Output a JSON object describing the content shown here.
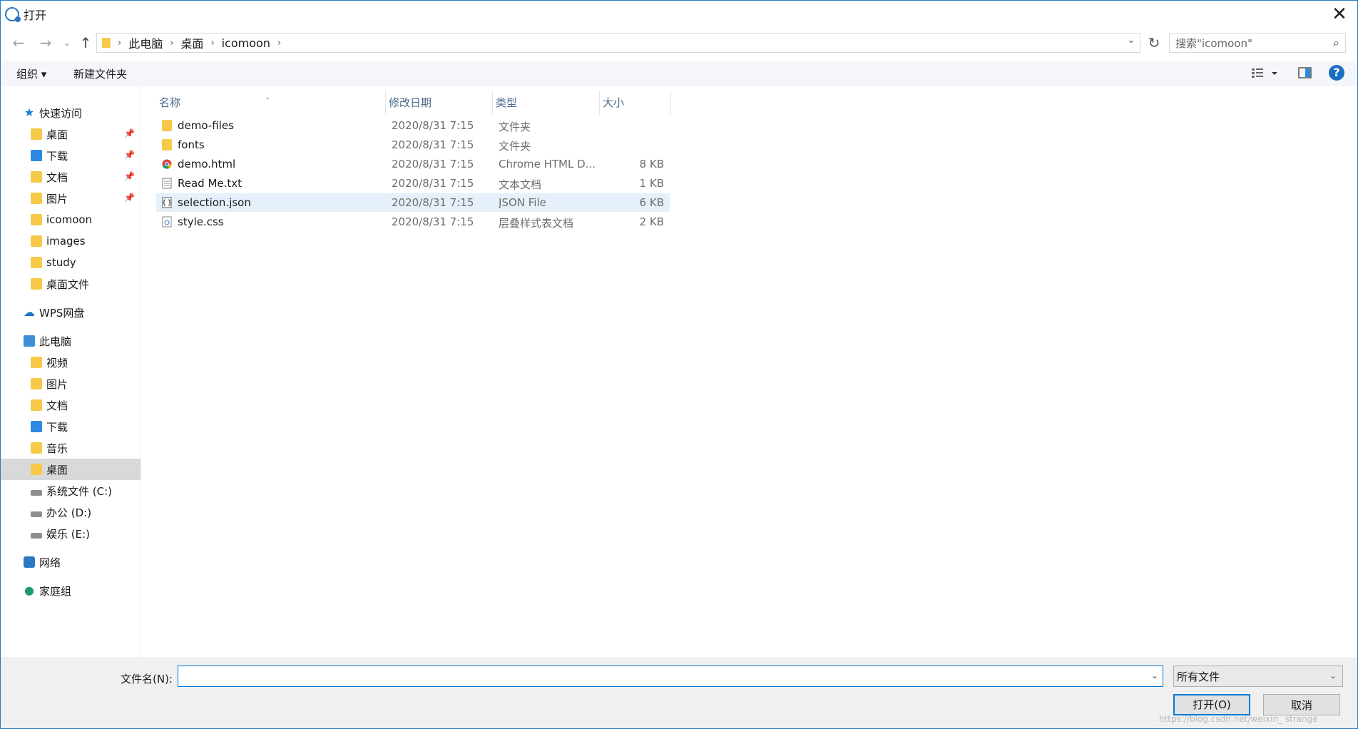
{
  "window": {
    "title": "打开",
    "close_symbol": "✕"
  },
  "nav": {
    "back": "←",
    "forward": "→",
    "recent": "⌄",
    "up": "↑",
    "refresh": "↻"
  },
  "breadcrumb": [
    "此电脑",
    "桌面",
    "icomoon"
  ],
  "search": {
    "placeholder": "搜索\"icomoon\""
  },
  "toolbar": {
    "organize": "组织 ▾",
    "new_folder": "新建文件夹"
  },
  "sidebar": {
    "quick_access": "快速访问",
    "quick_items": [
      {
        "label": "桌面",
        "pinned": true
      },
      {
        "label": "下载",
        "pinned": true
      },
      {
        "label": "文档",
        "pinned": true
      },
      {
        "label": "图片",
        "pinned": true
      },
      {
        "label": "icomoon",
        "pinned": false
      },
      {
        "label": "images",
        "pinned": false
      },
      {
        "label": "study",
        "pinned": false
      },
      {
        "label": "桌面文件",
        "pinned": false
      }
    ],
    "wps": "WPS网盘",
    "this_pc": "此电脑",
    "pc_items": [
      {
        "label": "视频"
      },
      {
        "label": "图片"
      },
      {
        "label": "文档"
      },
      {
        "label": "下载"
      },
      {
        "label": "音乐"
      },
      {
        "label": "桌面",
        "selected": true
      },
      {
        "label": "系统文件 (C:)"
      },
      {
        "label": "办公 (D:)"
      },
      {
        "label": "娱乐 (E:)"
      }
    ],
    "network": "网络",
    "homegroup": "家庭组"
  },
  "columns": {
    "name": "名称",
    "date": "修改日期",
    "type": "类型",
    "size": "大小"
  },
  "files": [
    {
      "name": "demo-files",
      "date": "2020/8/31 7:15",
      "type": "文件夹",
      "size": "",
      "icon": "folder-icon"
    },
    {
      "name": "fonts",
      "date": "2020/8/31 7:15",
      "type": "文件夹",
      "size": "",
      "icon": "folder-icon"
    },
    {
      "name": "demo.html",
      "date": "2020/8/31 7:15",
      "type": "Chrome HTML D...",
      "size": "8 KB",
      "icon": "chrome-icon"
    },
    {
      "name": "Read Me.txt",
      "date": "2020/8/31 7:15",
      "type": "文本文档",
      "size": "1 KB",
      "icon": "text-file-icon"
    },
    {
      "name": "selection.json",
      "date": "2020/8/31 7:15",
      "type": "JSON File",
      "size": "6 KB",
      "icon": "json-file-icon",
      "selected": true
    },
    {
      "name": "style.css",
      "date": "2020/8/31 7:15",
      "type": "层叠样式表文档",
      "size": "2 KB",
      "icon": "css-file-icon"
    }
  ],
  "bottom": {
    "filename_label": "文件名(N):",
    "filename_value": "",
    "filetype": "所有文件",
    "open": "打开(O)",
    "cancel": "取消",
    "watermark": "https://blog.csdn.net/weixin_  strange"
  }
}
